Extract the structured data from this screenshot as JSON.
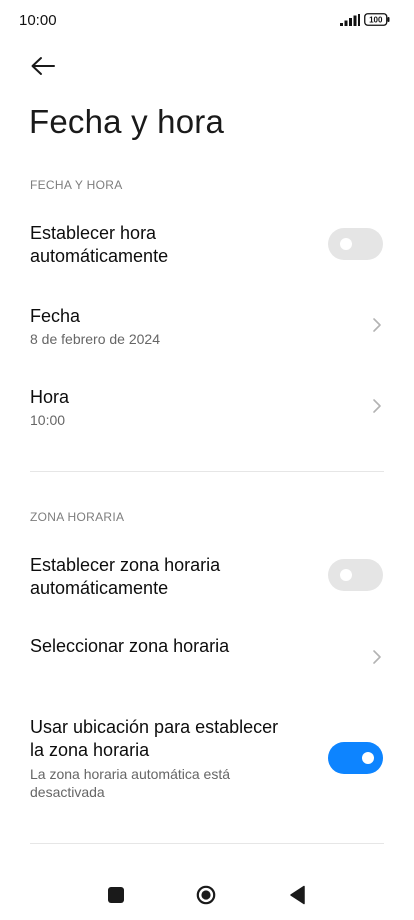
{
  "status_bar": {
    "time": "10:00",
    "battery_level": "100"
  },
  "header": {
    "title": "Fecha y hora"
  },
  "sections": {
    "date_time": {
      "header": "FECHA Y HORA",
      "auto_time": {
        "label_line1": "Establecer hora",
        "label_line2": "automáticamente",
        "enabled": false
      },
      "date": {
        "label": "Fecha",
        "value": "8 de febrero de 2024"
      },
      "time": {
        "label": "Hora",
        "value": "10:00"
      }
    },
    "time_zone": {
      "header": "ZONA HORARIA",
      "auto_zone": {
        "label_line1": "Establecer zona horaria",
        "label_line2": "automáticamente",
        "enabled": false
      },
      "select_zone": {
        "label": "Seleccionar zona horaria"
      },
      "use_location": {
        "label_line1": "Usar ubicación para establecer",
        "label_line2": "la zona horaria",
        "sub_line1": "La zona horaria automática está",
        "sub_line2": "desactivada",
        "enabled": true
      }
    }
  },
  "colors": {
    "accent": "#0d84ff",
    "toggle_off": "#e5e5e5",
    "section_header": "#7d7d7d"
  },
  "icons": {
    "back": "arrow-left-icon",
    "chevron": "chevron-right-icon",
    "signal": "signal-icon",
    "battery": "battery-icon",
    "nav_recents": "square-icon",
    "nav_home": "circle-icon",
    "nav_back": "triangle-icon"
  }
}
